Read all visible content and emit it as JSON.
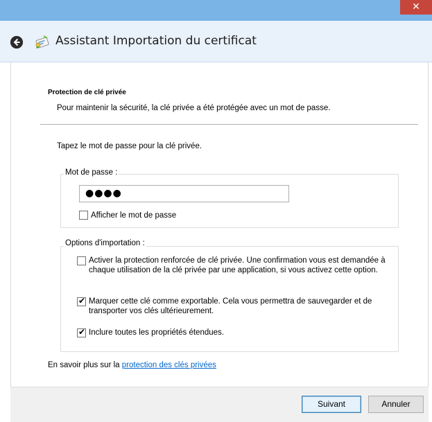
{
  "titlebar": {
    "close_glyph": "✕"
  },
  "header": {
    "back_icon": "back-arrow-icon",
    "cert_icon": "certificate-icon",
    "title": "Assistant Importation du certificat"
  },
  "page": {
    "section_title": "Protection de clé privée",
    "section_desc": "Pour maintenir la sécurité, la clé privée a été protégée avec un mot de passe.",
    "instruction": "Tapez le mot de passe pour la clé privée."
  },
  "password_group": {
    "label": "Mot de passe :",
    "value": "●●●●",
    "show_password_label": "Afficher le mot de passe",
    "show_password_checked": false
  },
  "options_group": {
    "label": "Options d'importation :",
    "options": [
      {
        "label": "Activer la protection renforcée de clé privée. Une confirmation vous est demandée à chaque utilisation de la clé privée par une application, si vous activez cette option.",
        "checked": false
      },
      {
        "label": "Marquer cette clé comme exportable. Cela vous permettra de sauvegarder et de transporter vos clés ultérieurement.",
        "checked": true
      },
      {
        "label": "Inclure toutes les propriétés étendues.",
        "checked": true
      }
    ]
  },
  "footer": {
    "text_prefix": "En savoir plus sur la ",
    "link_text": "protection des clés privées"
  },
  "buttons": {
    "next": "Suivant",
    "cancel": "Annuler"
  },
  "colors": {
    "titlebar": "#7ab3e6",
    "close": "#c7463c",
    "link": "#0066cc"
  }
}
